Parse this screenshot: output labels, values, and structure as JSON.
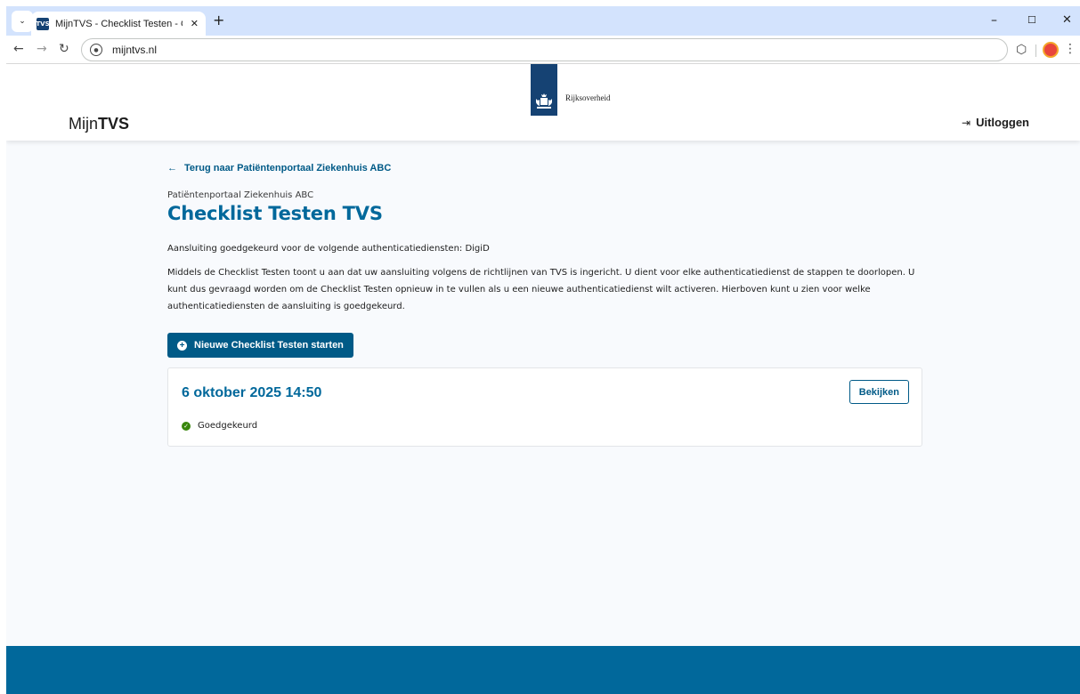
{
  "browser": {
    "tab_title": "MijnTVS - Checklist Testen - Ov",
    "favicon_text": "TVS",
    "url": "mijntvs.nl",
    "minimize": "–",
    "maximize": "☐",
    "close": "✕",
    "new_tab": "+",
    "tab_close": "✕",
    "back": "←",
    "forward": "→",
    "reload": "↻",
    "menu": "⌄",
    "extensions": "⬡",
    "kebab": "⋮"
  },
  "header": {
    "logo_light": "Mijn",
    "logo_bold": "TVS",
    "government_label": "Rijksoverheid",
    "logout_icon": "⇥",
    "logout_label": "Uitloggen"
  },
  "content": {
    "back_arrow": "←",
    "back_link": "Terug naar Patiëntenportaal Ziekenhuis ABC",
    "context_label": "Patiëntenportaal Ziekenhuis ABC",
    "title": "Checklist Testen TVS",
    "approved_line": "Aansluiting goedgekeurd voor de volgende authenticatiediensten: DigiD",
    "description": "Middels de Checklist Testen toont u aan dat uw aansluiting volgens de richtlijnen van TVS is ingericht. U dient voor elke authenticatiedienst de stappen te doorlopen. U kunt dus gevraagd worden om de Checklist Testen opnieuw in te vullen als u een nieuwe authenticatiedienst wilt activeren. Hierboven kunt u zien voor welke authenticatiediensten de aansluiting is goedgekeurd.",
    "new_checklist_icon": "+",
    "new_checklist_button": "Nieuwe Checklist Testen starten",
    "checklists": [
      {
        "date": "6 oktober 2025 14:50",
        "view_label": "Bekijken",
        "status_icon": "✓",
        "status": "Goedgekeurd"
      }
    ]
  },
  "colors": {
    "brand_blue": "#005a87",
    "title_blue": "#00689b",
    "rijks_blue": "#154273",
    "status_green": "#39870c",
    "footer_blue": "#01689b"
  }
}
